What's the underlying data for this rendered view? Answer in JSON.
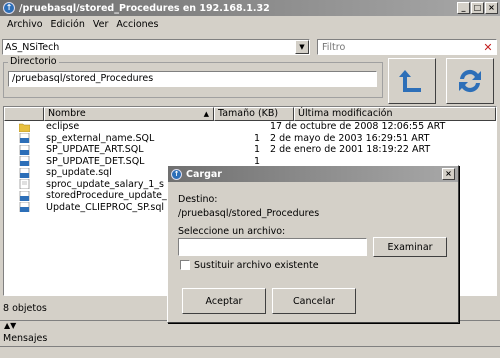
{
  "window": {
    "title": "/pruebasql/stored_Procedures en 192.168.1.32",
    "icon": "app-icon"
  },
  "menu": [
    "Archivo",
    "Edición",
    "Ver",
    "Acciones"
  ],
  "connection": {
    "selected": "AS_NSiTech"
  },
  "filter": {
    "placeholder": "Filtro"
  },
  "directory": {
    "legend": "Directorio",
    "path": "/pruebasql/stored_Procedures"
  },
  "toolbar": {
    "up_icon": "up-arrow-icon",
    "refresh_icon": "refresh-icon"
  },
  "file_list": {
    "columns": [
      "Nombre",
      "Tamaño (KB)",
      "Última modificación"
    ],
    "rows": [
      {
        "icon": "folder",
        "name": "eclipse",
        "size": "",
        "modified": "17 de octubre de 2008 12:06:55 ART"
      },
      {
        "icon": "sql",
        "name": "sp_external_name.SQL",
        "size": "1",
        "modified": "2 de mayo de 2003 16:29:51 ART"
      },
      {
        "icon": "sql",
        "name": "SP_UPDATE_ART.SQL",
        "size": "1",
        "modified": "2 de enero de 2001 18:19:22 ART"
      },
      {
        "icon": "sql",
        "name": "SP_UPDATE_DET.SQL",
        "size": "1",
        "modified": ""
      },
      {
        "icon": "sql",
        "name": "sp_update.sql",
        "size": "",
        "modified": ""
      },
      {
        "icon": "file",
        "name": "sproc_update_salary_1_s",
        "size": "",
        "modified": ""
      },
      {
        "icon": "sql",
        "name": "storedProcedure_update_",
        "size": "",
        "modified": ""
      },
      {
        "icon": "sql",
        "name": "Update_CLIEPROC_SP.sql",
        "size": "",
        "modified": ""
      }
    ]
  },
  "status": {
    "count": "8 objetos"
  },
  "messages_label": "Mensajes",
  "dialog": {
    "title": "Cargar",
    "dest_label": "Destino:",
    "dest_path": "/pruebasql/stored_Procedures",
    "select_label": "Seleccione un archivo:",
    "file_value": "",
    "browse_label": "Examinar",
    "replace_label": "Sustituir archivo existente",
    "accept_label": "Aceptar",
    "cancel_label": "Cancelar"
  },
  "colors": {
    "icon_blue": "#2d6fb8",
    "folder_yellow": "#e8c040",
    "clear_red": "#c42020"
  }
}
